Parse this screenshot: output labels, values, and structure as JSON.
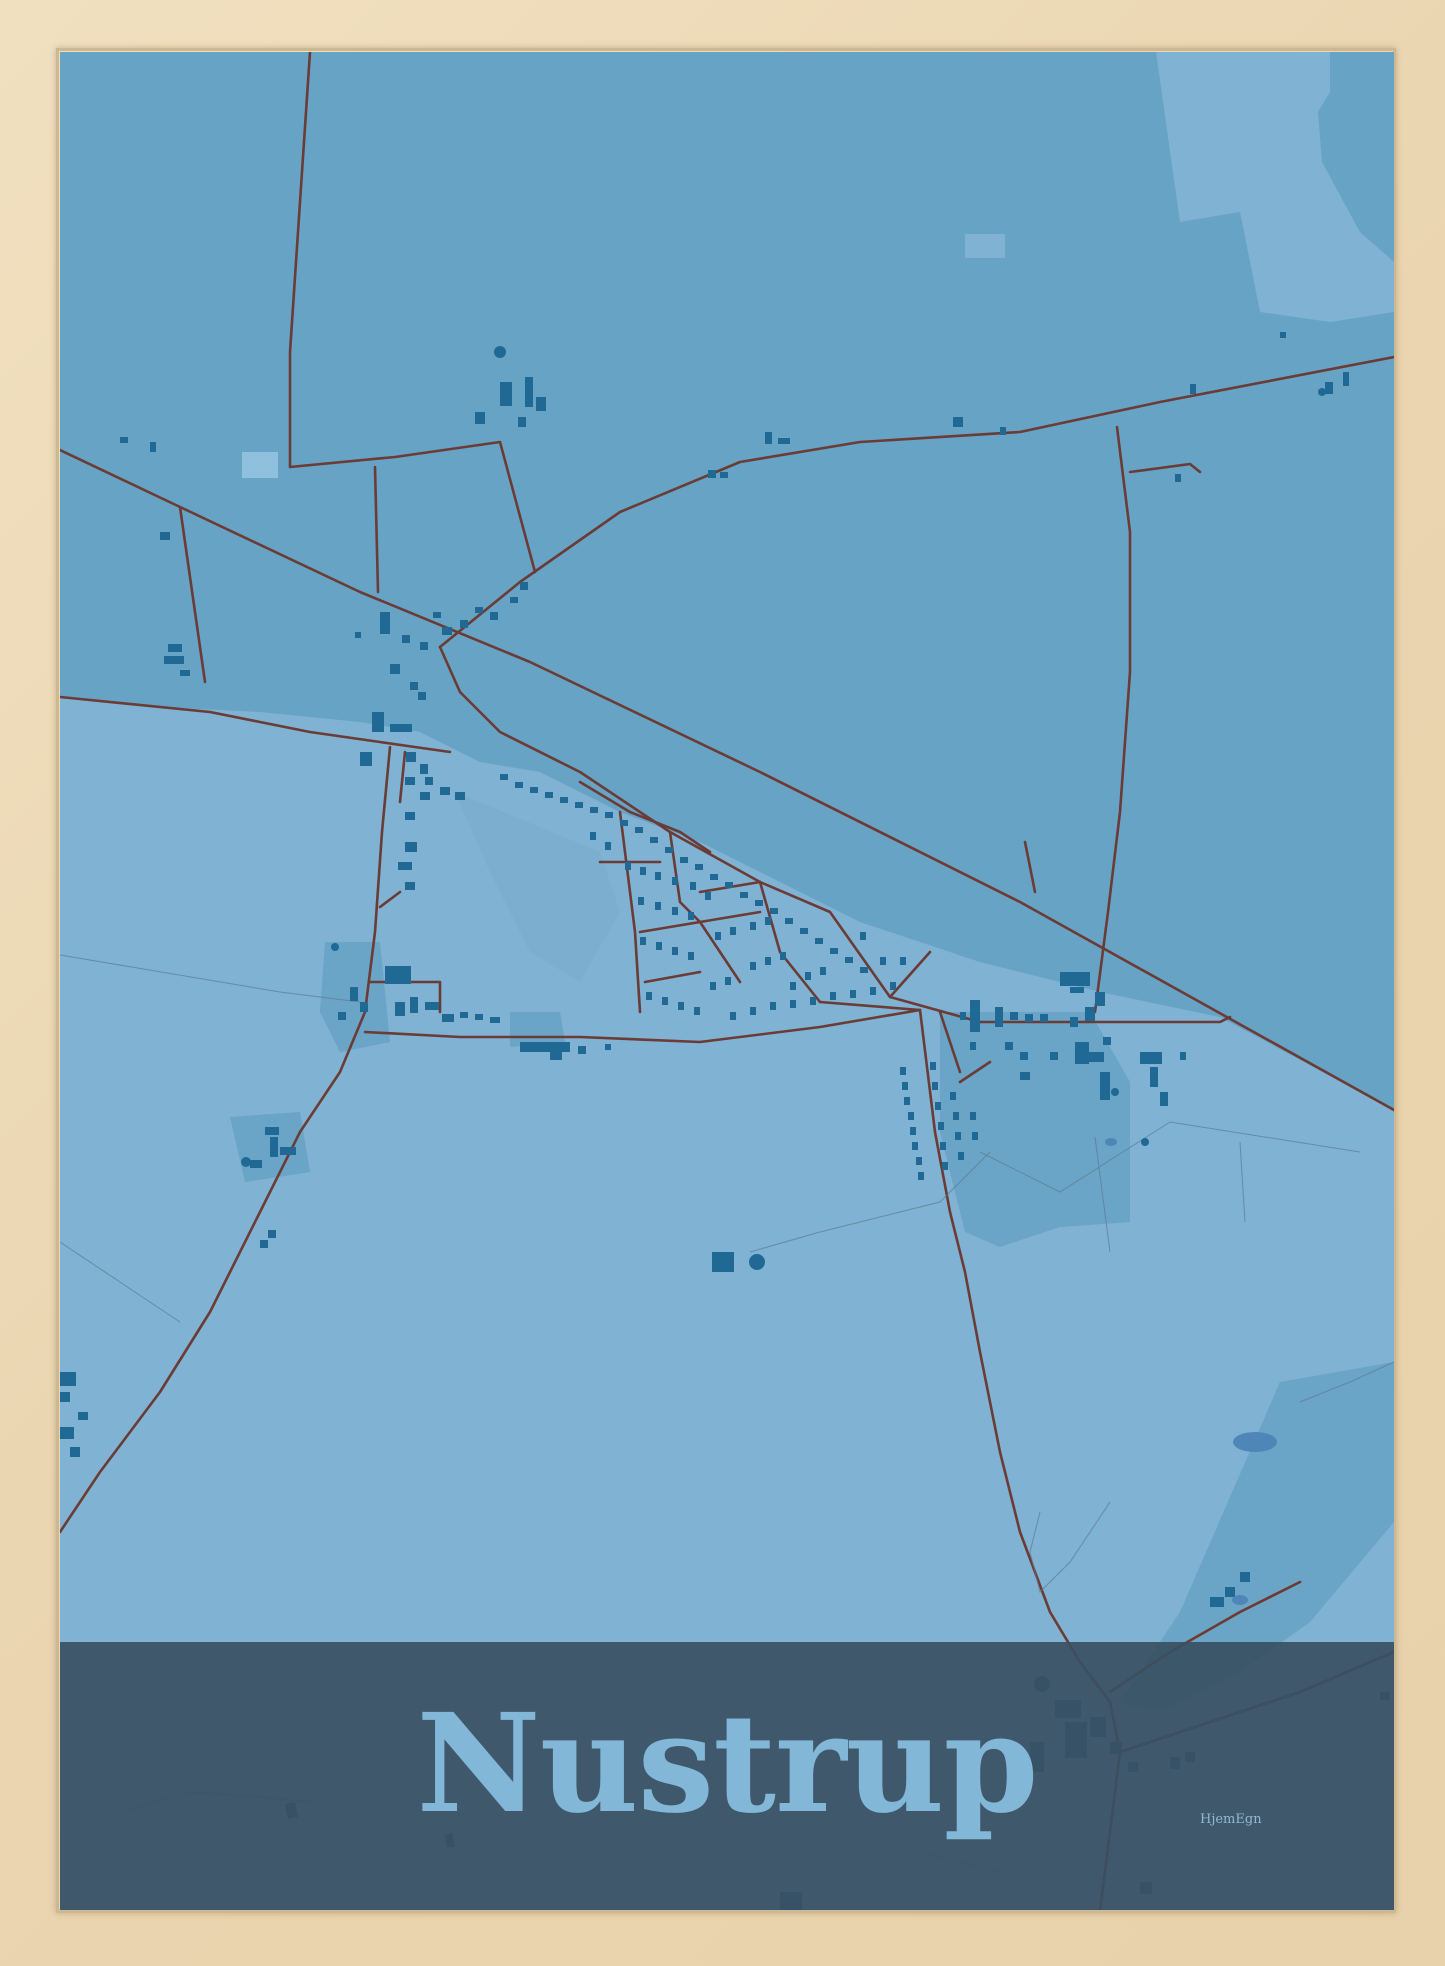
{
  "poster": {
    "place_name": "Nustrup",
    "brand": "HjemEgn"
  },
  "colors": {
    "frame_wood": "#ecd9b8",
    "map_field_light": "#7fb2d3",
    "map_field_dark": "#67a3c5",
    "buildings": "#1f6994",
    "roads": "#6b3b35",
    "title_band": "#3a5062",
    "title_text": "#82b7d8"
  }
}
